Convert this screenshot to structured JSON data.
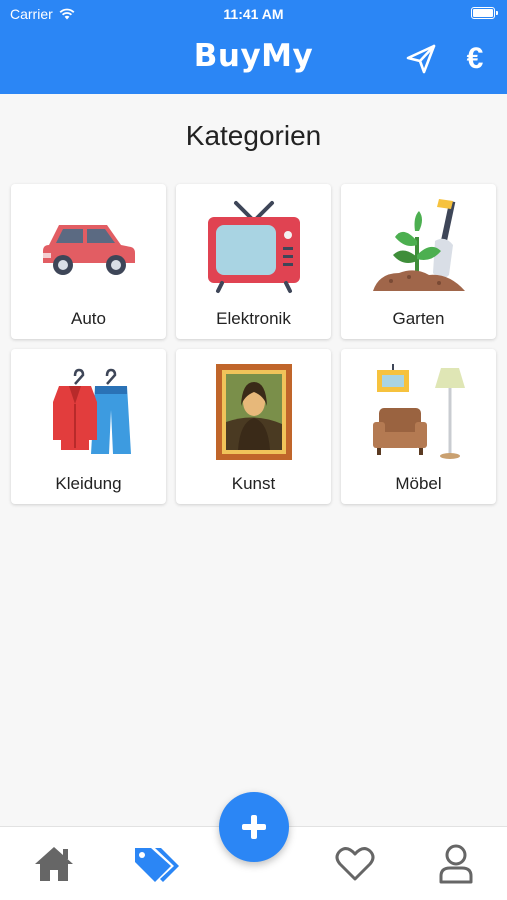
{
  "status_bar": {
    "carrier": "Carrier",
    "time": "11:41 AM"
  },
  "app_bar": {
    "title": "BuyMy",
    "currency_symbol": "€"
  },
  "page": {
    "title": "Kategorien"
  },
  "categories": [
    {
      "label": "Auto",
      "icon": "car-icon"
    },
    {
      "label": "Elektronik",
      "icon": "tv-icon"
    },
    {
      "label": "Garten",
      "icon": "garden-plant-icon"
    },
    {
      "label": "Kleidung",
      "icon": "clothes-icon"
    },
    {
      "label": "Kunst",
      "icon": "painting-icon"
    },
    {
      "label": "Möbel",
      "icon": "furniture-icon"
    }
  ],
  "tab_bar": {
    "active_tab": "categories",
    "tabs": [
      "home-icon",
      "tags-icon",
      "add-icon",
      "heart-icon",
      "user-icon"
    ]
  },
  "colors": {
    "primary": "#2b86f5",
    "background": "#f7f7f7",
    "inactive_icon": "#666666"
  }
}
